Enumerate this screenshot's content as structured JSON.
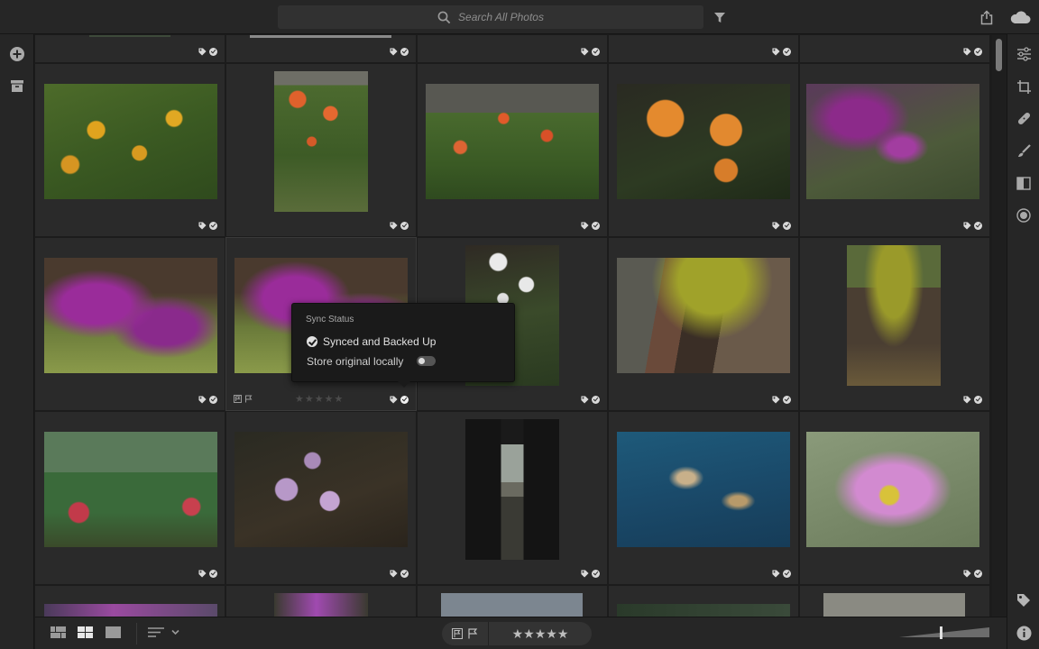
{
  "search": {
    "placeholder": "Search All Photos"
  },
  "icons": {
    "add": "plus-circle-icon",
    "archive": "archive-icon",
    "filter": "filter-icon",
    "share": "share-icon",
    "cloud": "cloud-icon",
    "tag_panel": "tag-icon",
    "info": "info-icon"
  },
  "right_tools": [
    "edit-sliders-icon",
    "crop-icon",
    "healing-icon",
    "brush-icon",
    "linear-gradient-icon",
    "radial-gradient-icon"
  ],
  "tooltip": {
    "title": "Sync Status",
    "status": "Synced and Backed Up",
    "store_label": "Store original locally",
    "store_enabled": false
  },
  "selected_cell_stars": "★★★★★",
  "bottom": {
    "view_modes": [
      "square-grid",
      "photo-grid",
      "detail"
    ],
    "active_view": "photo-grid",
    "rating_stars": "★★★★★",
    "rating_value": 0
  },
  "colors": {
    "accent_bg": "#262626",
    "grid_bg": "#1c1c1c",
    "cell_bg": "#2a2a2a"
  }
}
